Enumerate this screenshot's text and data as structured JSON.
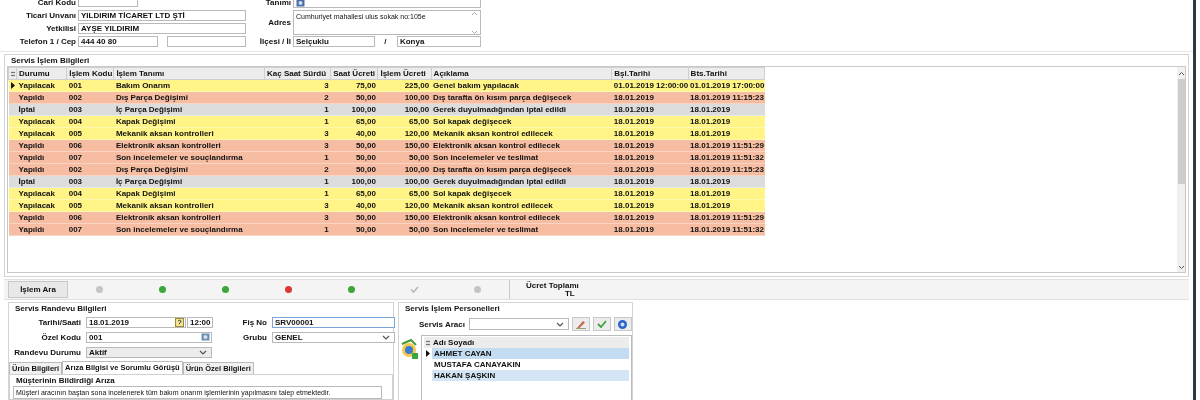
{
  "customer": {
    "code_label": "Cari Kodu",
    "name_label": "Tanımı",
    "trade_name": {
      "label": "Ticari Unvanı",
      "value": "YILDIRIM TİCARET LTD ŞTİ"
    },
    "contact": {
      "label": "Yetkilisi",
      "value": "AYŞE YILDIRIM"
    },
    "phone": {
      "label": "Telefon 1 / Cep",
      "value": "444 40 80"
    },
    "address": {
      "label": "Adres",
      "value": "Cumhuriyet mahallesi ulus sokak no:105e"
    },
    "district": {
      "label": "İlçesi / İl",
      "value": "Selçuklu",
      "separator": "/",
      "city": "Konya"
    }
  },
  "service_ops": {
    "title": "Servis İşlem Bilgileri",
    "columns": [
      "Durumu",
      "İşlem Kodu",
      "İşlem Tanımı",
      "Kaç Saat Sürdü",
      "Saat Ücreti",
      "İşlem Ücreti",
      "Açıklama",
      "Bşl.Tarihi",
      "Bts.Tarihi"
    ],
    "rows": [
      {
        "kind": "planned",
        "selected": true,
        "cells": [
          "Yapılacak",
          "001",
          "Bakım Onarım",
          "3",
          "75,00",
          "225,00",
          "Genel bakım yapılacak",
          "01.01.2019 12:00:00",
          "01.01.2019 17:00:00"
        ]
      },
      {
        "kind": "done",
        "selected": false,
        "cells": [
          "Yapıldı",
          "002",
          "Dış Parça Değişimi",
          "2",
          "50,00",
          "100,00",
          "Dış tarafta ön kısım parça değişecek",
          "18.01.2019",
          "18.01.2019 11:15:23"
        ]
      },
      {
        "kind": "cancelled",
        "selected": false,
        "cells": [
          "İptal",
          "003",
          "İç Parça Değişimi",
          "1",
          "100,00",
          "100,00",
          "Gerek duyulmadığından iptal edildi",
          "18.01.2019",
          "18.01.2019"
        ]
      },
      {
        "kind": "planned",
        "selected": false,
        "cells": [
          "Yapılacak",
          "004",
          "Kapak Değişimi",
          "1",
          "65,00",
          "65,00",
          "Sol kapak değişecek",
          "18.01.2019",
          "18.01.2019"
        ]
      },
      {
        "kind": "planned",
        "selected": false,
        "cells": [
          "Yapılacak",
          "005",
          "Mekanik aksan kontrolleri",
          "3",
          "40,00",
          "120,00",
          "Mekanik aksan kontrol edilecek",
          "18.01.2019",
          "18.01.2019"
        ]
      },
      {
        "kind": "done",
        "selected": false,
        "cells": [
          "Yapıldı",
          "006",
          "Elektronik aksan kontrolleri",
          "3",
          "50,00",
          "150,00",
          "Elektronik aksan kontrol edilecek",
          "18.01.2019",
          "18.01.2019 11:51:29"
        ]
      },
      {
        "kind": "done",
        "selected": false,
        "cells": [
          "Yapıldı",
          "007",
          "Son incelemeler ve souçlandırma",
          "1",
          "50,00",
          "50,00",
          "Son incelemeler ve teslimat",
          "18.01.2019",
          "18.01.2019 11:51:32"
        ]
      },
      {
        "kind": "done",
        "selected": false,
        "cells": [
          "Yapıldı",
          "002",
          "Dış Parça Değişimi",
          "2",
          "50,00",
          "100,00",
          "Dış tarafta ön kısım parça değişecek",
          "18.01.2019",
          "18.01.2019 11:15:23"
        ]
      },
      {
        "kind": "cancelled",
        "selected": false,
        "cells": [
          "İptal",
          "003",
          "İç Parça Değişimi",
          "1",
          "100,00",
          "100,00",
          "Gerek duyulmadığından iptal edildi",
          "18.01.2019",
          "18.01.2019"
        ]
      },
      {
        "kind": "planned",
        "selected": false,
        "cells": [
          "Yapılacak",
          "004",
          "Kapak Değişimi",
          "1",
          "65,00",
          "65,00",
          "Sol kapak değişecek",
          "18.01.2019",
          "18.01.2019"
        ]
      },
      {
        "kind": "planned",
        "selected": false,
        "cells": [
          "Yapılacak",
          "005",
          "Mekanik aksan kontrolleri",
          "3",
          "40,00",
          "120,00",
          "Mekanik aksan kontrol edilecek",
          "18.01.2019",
          "18.01.2019"
        ]
      },
      {
        "kind": "done",
        "selected": false,
        "cells": [
          "Yapıldı",
          "006",
          "Elektronik aksan kontrolleri",
          "3",
          "50,00",
          "150,00",
          "Elektronik aksan kontrol edilecek",
          "18.01.2019",
          "18.01.2019 11:51:29"
        ]
      },
      {
        "kind": "done",
        "selected": false,
        "cells": [
          "Yapıldı",
          "007",
          "Son incelemeler ve souçlandırma",
          "1",
          "50,00",
          "50,00",
          "Son incelemeler ve teslimat",
          "18.01.2019",
          "18.01.2019 11:51:32"
        ]
      }
    ]
  },
  "toolbar": {
    "search_button": "İşlem Ara",
    "icons": [
      {
        "kind": "dot",
        "color": "#c4c4c4"
      },
      {
        "kind": "dot",
        "color": "#3ca63a"
      },
      {
        "kind": "dot",
        "color": "#3ca63a"
      },
      {
        "kind": "dot",
        "color": "#d83838"
      },
      {
        "kind": "dot",
        "color": "#3ca63a"
      },
      {
        "kind": "check",
        "color": "#b8b8b8"
      },
      {
        "kind": "dot",
        "color": "#c4c4c4"
      }
    ],
    "total": {
      "label": "Ücret Toplamı",
      "currency": "TL"
    }
  },
  "appointment": {
    "title": "Servis Randevu Bilgileri",
    "date": {
      "label": "Tarihi/Saati",
      "value": "18.01.2019",
      "time": "12:00"
    },
    "special_code": {
      "label": "Özel Kodu",
      "value": "001"
    },
    "status": {
      "label": "Randevu Durumu",
      "value": "Aktif"
    },
    "slip_no": {
      "label": "Fiş No",
      "value": "SRV00001"
    },
    "group": {
      "label": "Grubu",
      "value": "GENEL"
    },
    "tabs": [
      {
        "label": "Ürün Bilgileri",
        "selected": false
      },
      {
        "label": "Arıza Bilgisi ve Sorumlu Görüşü",
        "selected": true
      },
      {
        "label": "Ürün Özel Bilgileri",
        "selected": false
      }
    ],
    "fault": {
      "title": "Müşterinin Bildirdiği Arıza",
      "text": "Müşteri aracının baştan sona incelenerek tüm bakım onarım işlemlerinin yapılmasını talep etmektedir."
    }
  },
  "personnel": {
    "title": "Servis İşlem Personelleri",
    "tool_label": "Servis Aracı",
    "column": "Adı Soyadı",
    "rows": [
      {
        "name": "AHMET CAYAN",
        "selected": true
      },
      {
        "name": "MUSTAFA CANAYAKIN",
        "selected": false
      },
      {
        "name": "HAKAN ŞAŞKIN",
        "selected": false
      }
    ]
  }
}
